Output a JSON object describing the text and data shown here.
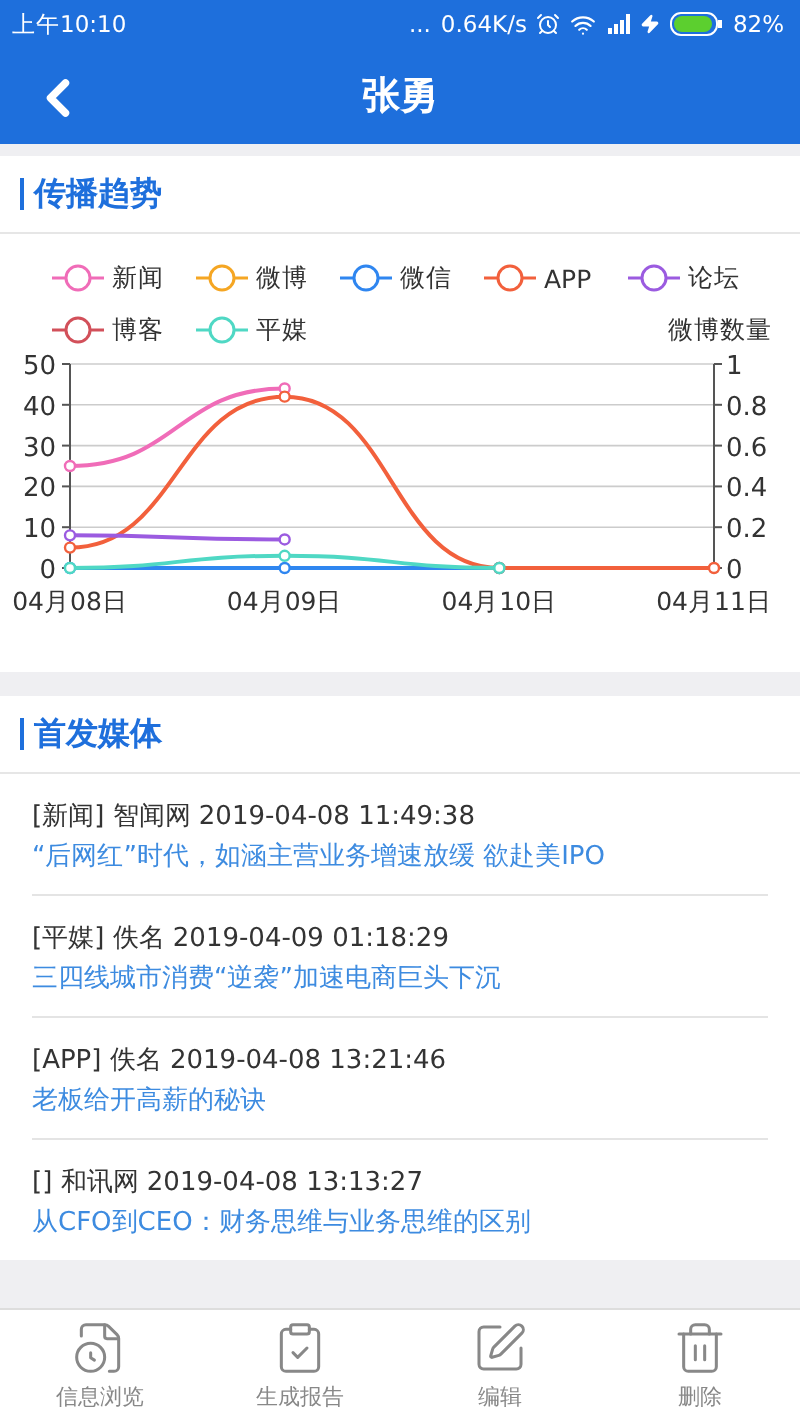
{
  "status_bar": {
    "time": "上午10:10",
    "dots": "...",
    "speed": "0.64K/s",
    "battery": "82%"
  },
  "nav": {
    "title": "张勇"
  },
  "trend": {
    "title": "传播趋势",
    "chart_data": {
      "type": "line",
      "ylabel": "微博数量",
      "categories": [
        "04月08日",
        "04月09日",
        "04月10日",
        "04月11日"
      ],
      "ylim": [
        0,
        50
      ],
      "y2lim": [
        0,
        1
      ],
      "grid": true,
      "yticks": [
        0,
        10,
        20,
        30,
        40,
        50
      ],
      "y2ticks": [
        0,
        0.2,
        0.4,
        0.6,
        0.8,
        1
      ],
      "series": [
        {
          "name": "新闻",
          "color": "#f06cb8",
          "marker": true,
          "values": [
            25,
            44,
            null,
            null
          ]
        },
        {
          "name": "微博",
          "color": "#f5a623",
          "values": [
            null,
            null,
            null,
            null
          ]
        },
        {
          "name": "微信",
          "color": "#2f86f0",
          "marker": true,
          "values": [
            0,
            0,
            0,
            null
          ]
        },
        {
          "name": "APP",
          "color": "#f2603c",
          "marker": true,
          "values": [
            5,
            42,
            0,
            0
          ]
        },
        {
          "name": "论坛",
          "color": "#9b5be0",
          "marker": true,
          "values": [
            8,
            7,
            null,
            null
          ]
        },
        {
          "name": "博客",
          "color": "#d2505a",
          "values": [
            null,
            null,
            null,
            null
          ]
        },
        {
          "name": "平媒",
          "color": "#4fd8c4",
          "marker": true,
          "values": [
            0,
            3,
            0,
            null
          ]
        }
      ]
    }
  },
  "first_media": {
    "title": "首发媒体",
    "items": [
      {
        "meta": "[新闻] 智闻网 2019-04-08 11:49:38",
        "headline": "“后网红”时代，如涵主营业务增速放缓 欲赴美IPO"
      },
      {
        "meta": "[平媒] 佚名 2019-04-09 01:18:29",
        "headline": "三四线城市消费“逆袭”加速电商巨头下沉"
      },
      {
        "meta": "[APP] 佚名 2019-04-08 13:21:46",
        "headline": "老板给开高薪的秘诀"
      },
      {
        "meta": "[] 和讯网 2019-04-08 13:13:27",
        "headline": "从CFO到CEO：财务思维与业务思维的区别"
      }
    ]
  },
  "tab_bar": [
    {
      "kind": "browse",
      "label": "信息浏览"
    },
    {
      "kind": "report",
      "label": "生成报告"
    },
    {
      "kind": "edit",
      "label": "编辑"
    },
    {
      "kind": "delete",
      "label": "删除"
    }
  ]
}
